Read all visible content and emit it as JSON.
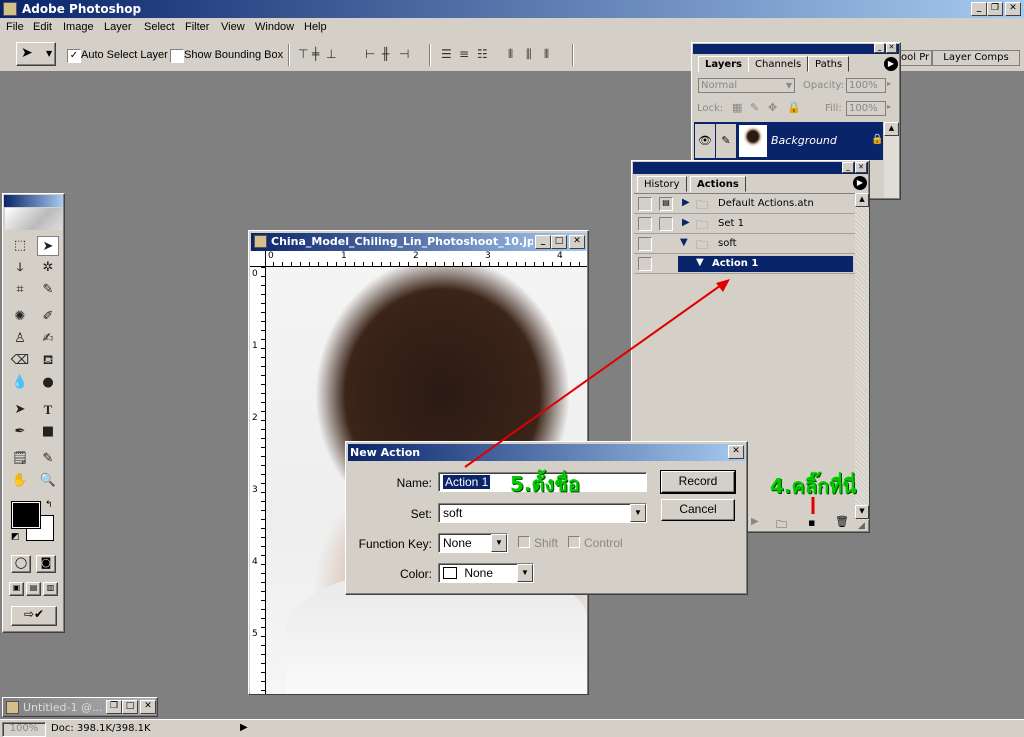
{
  "app": {
    "title": "Adobe Photoshop"
  },
  "menu": [
    "File",
    "Edit",
    "Image",
    "Layer",
    "Select",
    "Filter",
    "View",
    "Window",
    "Help"
  ],
  "options": {
    "auto_select": "Auto Select Layer",
    "bounding_box": "Show Bounding Box",
    "auto_select_checked": true,
    "bounding_box_checked": false
  },
  "well_tabs": {
    "tool_presets": "ool Pr",
    "layer_comps": "Layer Comps"
  },
  "layers_panel": {
    "tabs": [
      "Layers",
      "Channels",
      "Paths"
    ],
    "blend_mode": "Normal",
    "opacity_label": "Opacity:",
    "opacity": "100%",
    "lock_label": "Lock:",
    "fill_label": "Fill:",
    "fill": "100%",
    "layer_name": "Background"
  },
  "actions_panel": {
    "tabs": [
      "History",
      "Actions"
    ],
    "rows": [
      {
        "name": "Default Actions.atn",
        "type": "set"
      },
      {
        "name": "Set 1",
        "type": "set"
      },
      {
        "name": "soft",
        "type": "set"
      },
      {
        "name": "Action 1",
        "type": "action"
      }
    ]
  },
  "document": {
    "title": "China_Model_Chiling_Lin_Photoshoot_10.jp...",
    "ruler_h": [
      "0",
      "1",
      "2",
      "3",
      "4"
    ],
    "ruler_v": [
      "0",
      "1",
      "2",
      "3",
      "4",
      "5"
    ]
  },
  "dialog": {
    "title": "New Action",
    "name_label": "Name:",
    "name_value": "Action 1",
    "set_label": "Set:",
    "set_value": "soft",
    "fkey_label": "Function Key:",
    "fkey_value": "None",
    "shift_label": "Shift",
    "control_label": "Control",
    "color_label": "Color:",
    "color_value": "None",
    "record": "Record",
    "cancel": "Cancel"
  },
  "annotations": {
    "name_hint": "5.ตั้งชื่อ",
    "click_hint": "4.คลิ๊กที่นี่",
    "color": "#00cc00",
    "arrow_color": "#e00000"
  },
  "minimized_doc": {
    "title": "Untitled-1 @..."
  },
  "status": {
    "zoom": "100%",
    "doc": "Doc: 398.1K/398.1K"
  },
  "colors": {
    "titlebar": "#0a246a",
    "chrome": "#d4d0c8",
    "workspace": "#808080",
    "selection": "#0a246a"
  }
}
